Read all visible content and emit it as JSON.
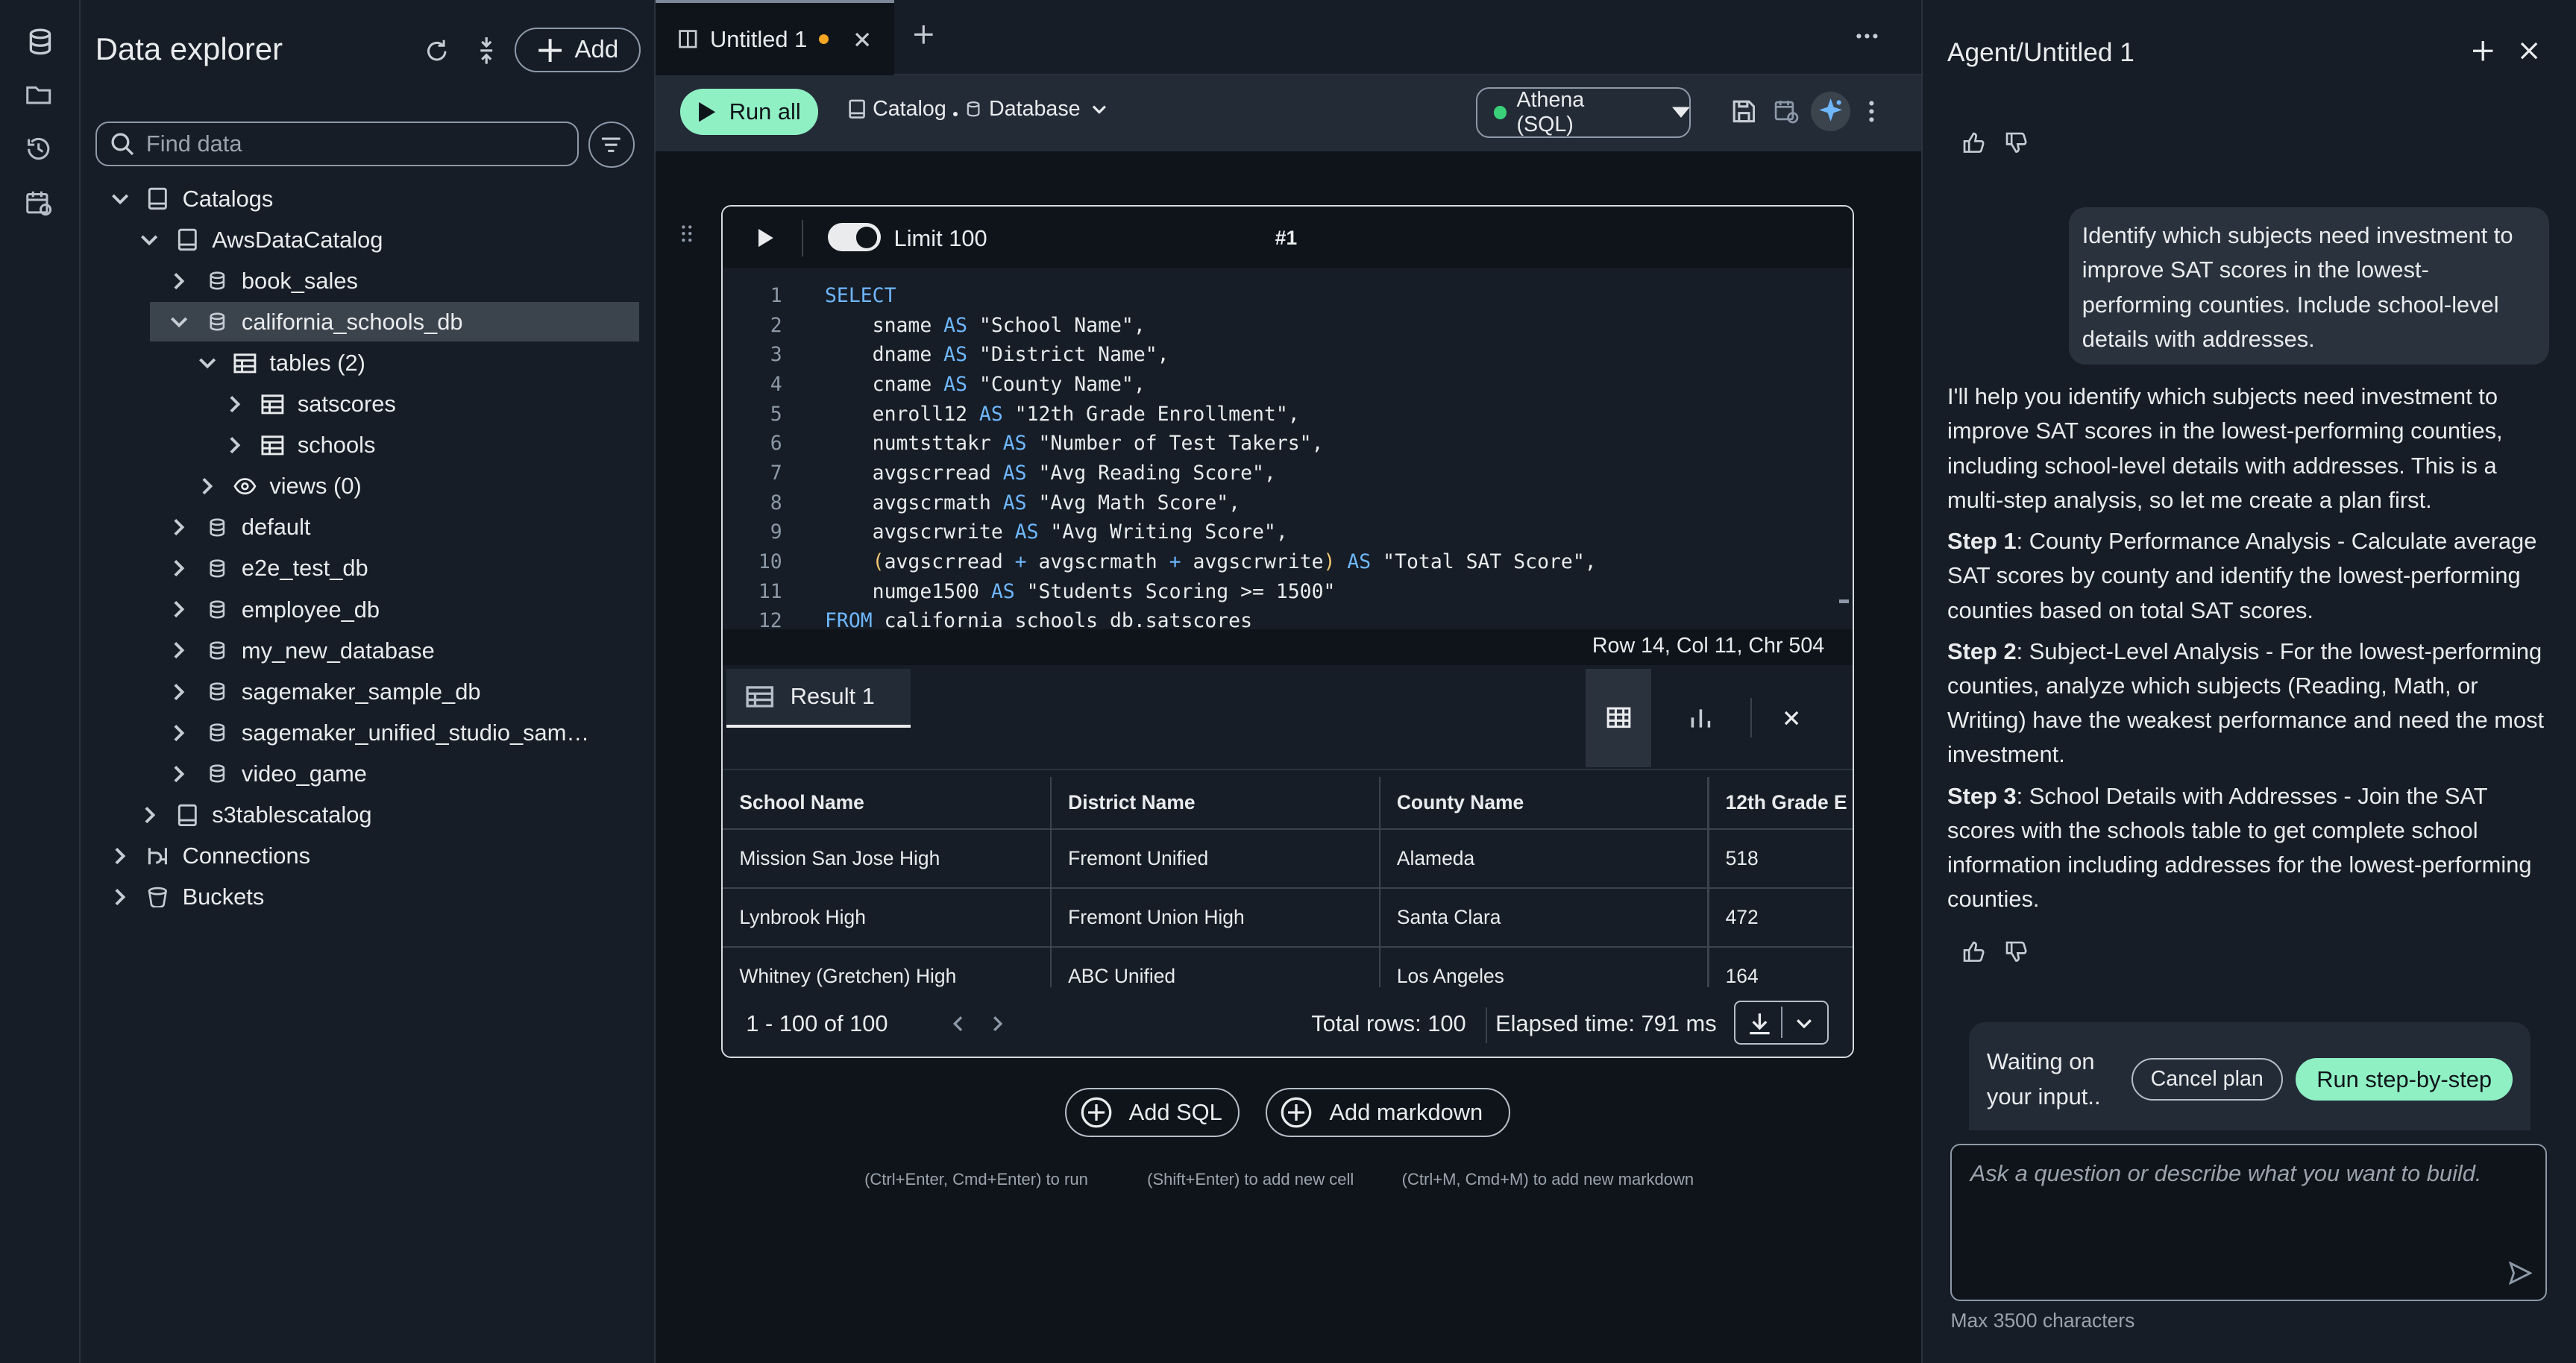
{
  "rail": {
    "icons": [
      "database-icon",
      "folder-icon",
      "history-icon",
      "scheduler-icon"
    ]
  },
  "explorer": {
    "title": "Data explorer",
    "add_label": "Add",
    "search_placeholder": "Find data",
    "tree": [
      {
        "label": "Catalogs",
        "icon": "catalog-icon"
      },
      {
        "label": "AwsDataCatalog",
        "icon": "catalog-icon"
      },
      {
        "label": "book_sales",
        "icon": "database-icon"
      },
      {
        "label": "california_schools_db",
        "icon": "database-icon"
      },
      {
        "label": "tables (2)",
        "icon": "table-icon"
      },
      {
        "label": "satscores",
        "icon": "table-icon"
      },
      {
        "label": "schools",
        "icon": "table-icon"
      },
      {
        "label": "views (0)",
        "icon": "eye-icon"
      },
      {
        "label": "default",
        "icon": "database-icon"
      },
      {
        "label": "e2e_test_db",
        "icon": "database-icon"
      },
      {
        "label": "employee_db",
        "icon": "database-icon"
      },
      {
        "label": "my_new_database",
        "icon": "database-icon"
      },
      {
        "label": "sagemaker_sample_db",
        "icon": "database-icon"
      },
      {
        "label": "sagemaker_unified_studio_sam…",
        "icon": "database-icon"
      },
      {
        "label": "video_game",
        "icon": "database-icon"
      },
      {
        "label": "s3tablescatalog",
        "icon": "catalog-icon"
      },
      {
        "label": "Connections",
        "icon": "connection-icon"
      },
      {
        "label": "Buckets",
        "icon": "bucket-icon"
      }
    ]
  },
  "tabs": {
    "active_title": "Untitled 1",
    "modified": true
  },
  "toolbar": {
    "run_all_label": "Run all",
    "catalog_label": "Catalog",
    "database_label": "Database",
    "engine_label": "Athena (SQL)"
  },
  "cell": {
    "limit_label": "Limit 100",
    "cell_number": "#1",
    "code_lines": [
      {
        "n": "1",
        "text": "SELECT"
      },
      {
        "n": "2",
        "text": "    sname AS \"School Name\","
      },
      {
        "n": "3",
        "text": "    dname AS \"District Name\","
      },
      {
        "n": "4",
        "text": "    cname AS \"County Name\","
      },
      {
        "n": "5",
        "text": "    enroll12 AS \"12th Grade Enrollment\","
      },
      {
        "n": "6",
        "text": "    numtsttakr AS \"Number of Test Takers\","
      },
      {
        "n": "7",
        "text": "    avgscrread AS \"Avg Reading Score\","
      },
      {
        "n": "8",
        "text": "    avgscrmath AS \"Avg Math Score\","
      },
      {
        "n": "9",
        "text": "    avgscrwrite AS \"Avg Writing Score\","
      },
      {
        "n": "10",
        "text": "    (avgscrread + avgscrmath + avgscrwrite) AS \"Total SAT Score\","
      },
      {
        "n": "11",
        "text": "    numge1500 AS \"Students Scoring >= 1500\""
      },
      {
        "n": "12",
        "text": "FROM california_schools_db.satscores"
      }
    ],
    "cursor_status": "Row 14,  Col 11,  Chr 504",
    "result_tab": "Result 1",
    "columns": [
      "School Name",
      "District Name",
      "County Name",
      "12th Grade E"
    ],
    "rows": [
      [
        "Mission San Jose High",
        "Fremont Unified",
        "Alameda",
        "518"
      ],
      [
        "Lynbrook High",
        "Fremont Union High",
        "Santa Clara",
        "472"
      ],
      [
        "Whitney (Gretchen) High",
        "ABC Unified",
        "Los Angeles",
        "164"
      ]
    ],
    "pagination": "1 - 100 of 100",
    "total_rows": "Total rows: 100",
    "elapsed": "Elapsed time: 791 ms"
  },
  "notebook": {
    "add_sql_label": "Add SQL",
    "add_markdown_label": "Add markdown",
    "hint_run": "(Ctrl+Enter, Cmd+Enter) to run",
    "hint_cell": "(Shift+Enter) to add new cell",
    "hint_markdown": "(Ctrl+M, Cmd+M) to add new markdown"
  },
  "agent": {
    "title": "Agent/Untitled 1",
    "user_message": "Identify which subjects need investment to improve SAT scores in the lowest-performing counties. Include school-level details with addresses.",
    "intro": "I'll help you identify which subjects need investment to improve SAT scores in the lowest-performing counties, including school-level details with addresses. This is a multi-step analysis, so let me create a plan first.",
    "steps": [
      {
        "label": "Step 1",
        "text": ": County Performance Analysis - Calculate average SAT scores by county and identify the lowest-performing counties based on total SAT scores."
      },
      {
        "label": "Step 2",
        "text": ": Subject-Level Analysis - For the lowest-performing counties, analyze which subjects (Reading, Math, or Writing) have the weakest performance and need the most investment."
      },
      {
        "label": "Step 3",
        "text": ": School Details with Addresses - Join the SAT scores with the schools table to get complete school information including addresses for the lowest-performing counties."
      }
    ],
    "waiting_text": "Waiting on your input..",
    "cancel_label": "Cancel plan",
    "run_step_label": "Run step-by-step",
    "input_placeholder": "Ask a question or describe what you want to build.",
    "max_chars": "Max 3500 characters"
  },
  "colors": {
    "accent": "#8ff0c4",
    "status_dot": "#3ad07a",
    "modified_dot": "#f5a623"
  }
}
